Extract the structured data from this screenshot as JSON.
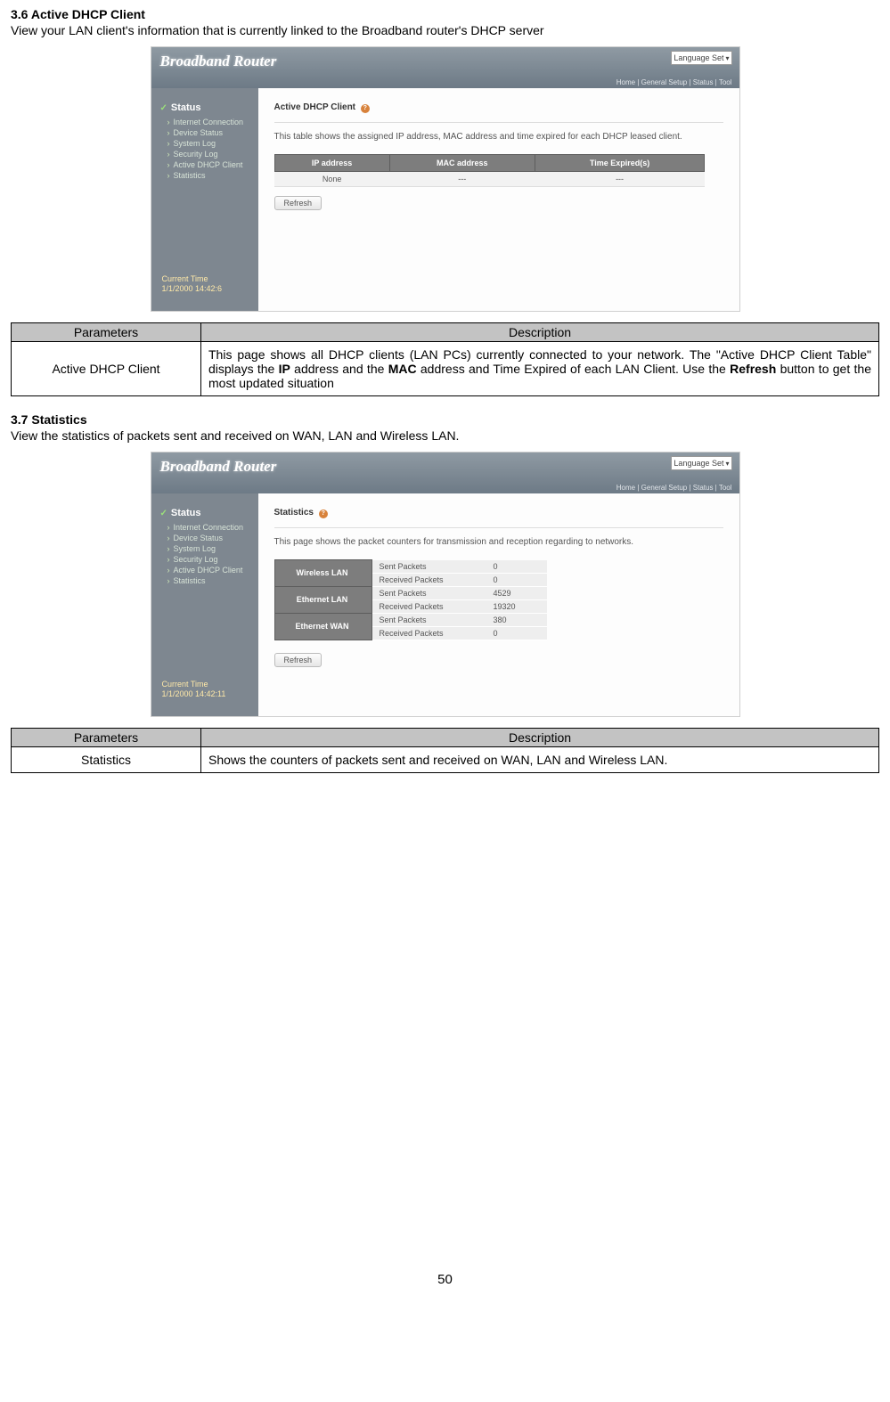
{
  "sec1": {
    "title": "3.6 Active DHCP Client",
    "intro": "View your LAN client's information that is currently linked to the Broadband router's DHCP server"
  },
  "sec2": {
    "title": "3.7 Statistics",
    "intro": "View the statistics of packets sent and received on WAN, LAN and Wireless LAN."
  },
  "router": {
    "brand": "Broadband Router",
    "lang": "Language Set",
    "crumbs": "Home | General Setup | Status | Tool"
  },
  "sidebar": {
    "status": "Status",
    "items": [
      "Internet Connection",
      "Device Status",
      "System Log",
      "Security Log",
      "Active DHCP Client",
      "Statistics"
    ],
    "time1_label": "Current Time",
    "time1_value": "1/1/2000 14:42:6",
    "time2_value": "1/1/2000 14:42:11"
  },
  "dhcp": {
    "panel_title": "Active DHCP Client",
    "desc": "This table shows the assigned IP address, MAC address and time expired for each DHCP leased client.",
    "th": [
      "IP address",
      "MAC address",
      "Time Expired(s)"
    ],
    "row": [
      "None",
      "---",
      "---"
    ]
  },
  "stats": {
    "panel_title": "Statistics",
    "desc": "This page shows the packet counters for transmission and reception regarding to networks.",
    "groups": [
      "Wireless LAN",
      "Ethernet LAN",
      "Ethernet WAN"
    ],
    "klabels": [
      "Sent Packets",
      "Received Packets"
    ],
    "vals": [
      [
        "0",
        "0"
      ],
      [
        "4529",
        "19320"
      ],
      [
        "380",
        "0"
      ]
    ]
  },
  "refresh_label": "Refresh",
  "t1": {
    "h1": "Parameters",
    "h2": "Description",
    "c1": "Active DHCP Client",
    "c2a": "This page shows all DHCP clients (LAN PCs) currently connected to your network. The \"Active DHCP Client Table\" displays the ",
    "c2b": "IP",
    "c2c": " address and the ",
    "c2d": "MAC",
    "c2e": " address and Time Expired of each LAN Client. Use the ",
    "c2f": "Refresh",
    "c2g": " button to get the most updated situation"
  },
  "t2": {
    "h1": "Parameters",
    "h2": "Description",
    "c1": "Statistics",
    "c2": "Shows the counters of packets sent and received on WAN, LAN and Wireless LAN."
  },
  "pagenum": "50"
}
